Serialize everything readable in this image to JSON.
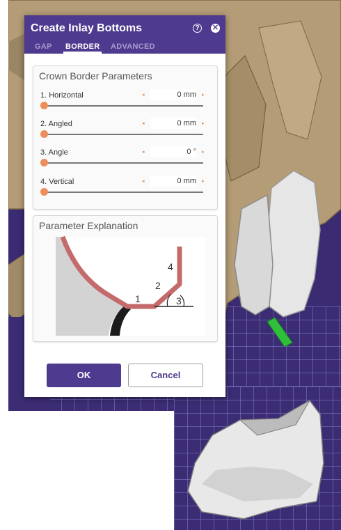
{
  "dialog": {
    "title": "Create Inlay Bottoms",
    "help_glyph": "?",
    "close_glyph": "✕",
    "tabs": [
      {
        "label": "GAP",
        "active": false
      },
      {
        "label": "BORDER",
        "active": true
      },
      {
        "label": "ADVANCED",
        "active": false
      }
    ]
  },
  "crown_border": {
    "title": "Crown Border Parameters",
    "arrow_left": "◂",
    "arrow_right": "▸",
    "params": [
      {
        "label": "1. Horizontal",
        "value": "0 mm",
        "slider_fraction": 0
      },
      {
        "label": "2. Angled",
        "value": "0 mm",
        "slider_fraction": 0
      },
      {
        "label": "3. Angle",
        "value": "0 °",
        "slider_fraction": 0
      },
      {
        "label": "4. Vertical",
        "value": "0 mm",
        "slider_fraction": 0
      }
    ]
  },
  "explanation": {
    "title": "Parameter Explanation",
    "labels": {
      "n1": "1",
      "n2": "2",
      "n3": "3",
      "n4": "4"
    }
  },
  "buttons": {
    "ok": "OK",
    "cancel": "Cancel"
  },
  "colors": {
    "header": "#4e3a8e",
    "slider_thumb": "#ec8d5a",
    "diagram_border": "#c46a6a",
    "grid_bg": "#3b2c74",
    "bone": "#b8a27c"
  }
}
